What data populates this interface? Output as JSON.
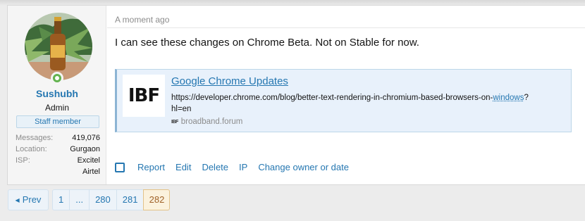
{
  "post": {
    "date": "A moment ago",
    "message": "I can see these changes on Chrome Beta. Not on Stable for now.",
    "user": {
      "name": "Sushubh",
      "title": "Admin",
      "banner": "Staff member",
      "stats": [
        {
          "label": "Messages:",
          "value": "419,076"
        },
        {
          "label": "Location:",
          "value": "Gurgaon"
        },
        {
          "label": "ISP:",
          "value": "Excitel"
        },
        {
          "label": "",
          "value": "Airtel"
        }
      ]
    },
    "unfurl": {
      "logo_text": "IBF",
      "title": "Google Chrome Updates",
      "url_part1": "https://developer.chrome.com/blog/better-text-rendering-in-chromium-based-browsers-on-",
      "url_highlight": "windows",
      "url_part2": "?",
      "url_line2": "hl=en",
      "favicon_text": "IBF",
      "site": "broadband.forum"
    },
    "actions": [
      "Report",
      "Edit",
      "Delete",
      "IP",
      "Change owner or date"
    ]
  },
  "pagination": {
    "prev_label": "Prev",
    "pages": [
      "1",
      "...",
      "280",
      "281"
    ],
    "current": "282"
  },
  "colors": {
    "link": "#2577b1",
    "online": "#63b34f",
    "current_page_bg": "#fbf2dd"
  },
  "icons": {
    "online_status": "online-dot-icon",
    "prev_arrow": "left-triangle-icon",
    "select": "checkbox-icon"
  }
}
